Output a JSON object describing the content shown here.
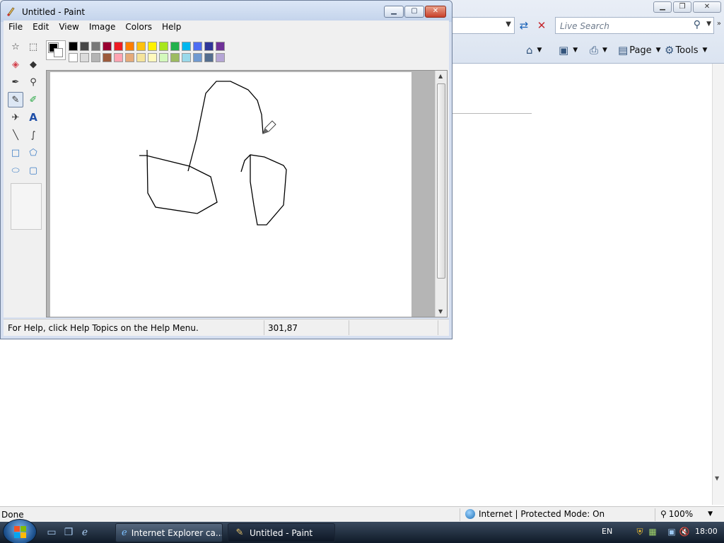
{
  "paint": {
    "title": "Untitled - Paint",
    "menu": [
      "File",
      "Edit",
      "View",
      "Image",
      "Colors",
      "Help"
    ],
    "status_help": "For Help, click Help Topics on the Help Menu.",
    "status_coords": "301,87",
    "foreground_color": "#000000",
    "background_color": "#ffffff",
    "palette_top": [
      "#000000",
      "#464646",
      "#787878",
      "#990030",
      "#ed1c24",
      "#ff7e00",
      "#ffc20e",
      "#fff200",
      "#a8e61d",
      "#22b14c",
      "#00b7ef",
      "#4d6df3",
      "#2f3699",
      "#6f3198"
    ],
    "palette_bottom": [
      "#ffffff",
      "#dcdcdc",
      "#b4b4b4",
      "#9c5a3c",
      "#ffa3b1",
      "#e5aa7a",
      "#f5e49c",
      "#fff9bd",
      "#d3f9bc",
      "#9dbb61",
      "#99d9ea",
      "#709ad1",
      "#546d8e",
      "#b5a5d5"
    ],
    "tools": [
      "free-form-select",
      "select",
      "eraser",
      "fill-with-color",
      "pick-color",
      "magnifier",
      "pencil",
      "brush",
      "airbrush",
      "text",
      "line",
      "curve",
      "rectangle",
      "polygon",
      "ellipse",
      "rounded-rectangle"
    ],
    "active_tool": "pencil"
  },
  "ie": {
    "search_placeholder": "Live Search",
    "page_label": "Page",
    "tools_label": "Tools",
    "status_done": "Done",
    "status_zone": "Internet | Protected Mode: On",
    "zoom": "100%",
    "icons": [
      "home-icon",
      "feeds-icon",
      "print-icon",
      "page-icon",
      "tools-gear-icon",
      "refresh-icon",
      "stop-icon",
      "search-icon"
    ]
  },
  "taskbar": {
    "tasks": [
      "Internet Explorer ca...",
      "Untitled - Paint"
    ],
    "active_task": "Untitled - Paint",
    "language": "EN",
    "clock": "18:00",
    "icons": [
      "start-orb",
      "show-desktop-icon",
      "switch-windows-icon",
      "ie-quicklaunch-icon",
      "security-shield-icon",
      "network-icon",
      "volume-muted-icon"
    ]
  }
}
